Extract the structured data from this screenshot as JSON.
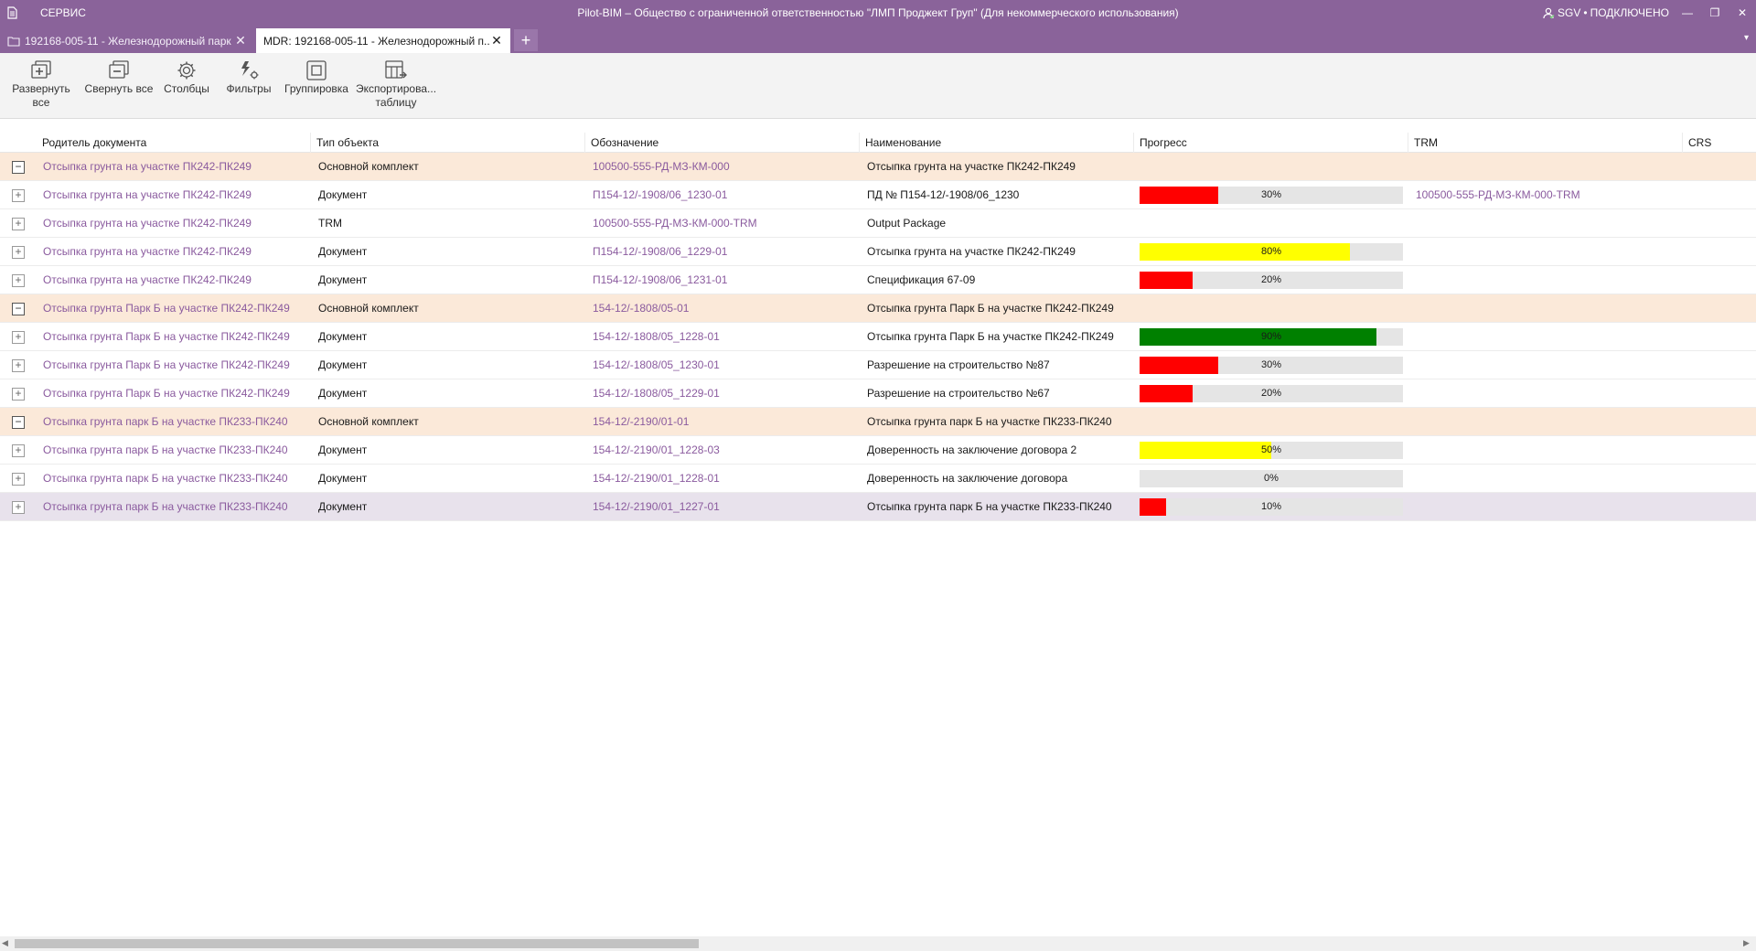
{
  "titlebar": {
    "menu": "СЕРВИС",
    "title": "Pilot-BIM – Общество с ограниченной ответственностью \"ЛМП Проджект Груп\" (Для некоммерческого использования)",
    "user": "SGV",
    "status": "ПОДКЛЮЧЕНО",
    "minimize": "—",
    "restore": "❐",
    "close": "✕"
  },
  "tabs": [
    {
      "label": "192168-005-11 - Железнодорожный парк",
      "close": "✕"
    },
    {
      "label": "MDR: 192168-005-11 - Железнодорожный п...",
      "close": "✕"
    }
  ],
  "tab_add": "+",
  "tab_menu": "▾",
  "toolbar": {
    "expand_all": "Развернуть все",
    "collapse_all": "Свернуть все",
    "columns": "Столбцы",
    "filters": "Фильтры",
    "grouping": "Группировка",
    "export_line1": "Экспортирова...",
    "export_line2": "таблицу"
  },
  "columns": {
    "parent": "Родитель документа",
    "type": "Тип объекта",
    "code": "Обозначение",
    "name": "Наименование",
    "progress": "Прогресс",
    "trm": "TRM",
    "crs": "CRS"
  },
  "rows": [
    {
      "group": true,
      "expander": "−",
      "parent": "Отсыпка грунта на участке ПК242-ПК249",
      "type": "Основной комплект",
      "code": "100500-555-РД-МЗ-КМ-000",
      "name": "Отсыпка грунта на участке ПК242-ПК249",
      "progress": null,
      "progress_label": "",
      "trm": ""
    },
    {
      "group": false,
      "expander": "+",
      "parent": "Отсыпка грунта на участке ПК242-ПК249",
      "type": "Документ",
      "code": "П154-12/-1908/06_1230-01",
      "name": "ПД № П154-12/-1908/06_1230",
      "progress": 0.3,
      "progress_label": "30%",
      "progress_color": "#ff0000",
      "trm": "100500-555-РД-МЗ-КМ-000-TRM"
    },
    {
      "group": false,
      "expander": "+",
      "parent": "Отсыпка грунта на участке ПК242-ПК249",
      "type": "TRM",
      "code": "100500-555-РД-МЗ-КМ-000-TRM",
      "name": "Output Package",
      "progress": null,
      "progress_label": "",
      "trm": ""
    },
    {
      "group": false,
      "expander": "+",
      "parent": "Отсыпка грунта на участке ПК242-ПК249",
      "type": "Документ",
      "code": "П154-12/-1908/06_1229-01",
      "name": "Отсыпка грунта на участке ПК242-ПК249",
      "progress": 0.8,
      "progress_label": "80%",
      "progress_color": "#ffff00",
      "trm": ""
    },
    {
      "group": false,
      "expander": "+",
      "parent": "Отсыпка грунта на участке ПК242-ПК249",
      "type": "Документ",
      "code": "П154-12/-1908/06_1231-01",
      "name": "Спецификация 67-09",
      "progress": 0.2,
      "progress_label": "20%",
      "progress_color": "#ff0000",
      "trm": ""
    },
    {
      "group": true,
      "expander": "−",
      "parent": "Отсыпка грунта Парк Б на участке ПК242-ПК249",
      "type": "Основной комплект",
      "code": "154-12/-1808/05-01",
      "name": "Отсыпка грунта Парк Б на участке ПК242-ПК249",
      "progress": null,
      "progress_label": "",
      "trm": ""
    },
    {
      "group": false,
      "expander": "+",
      "parent": "Отсыпка грунта Парк Б на участке ПК242-ПК249",
      "type": "Документ",
      "code": "154-12/-1808/05_1228-01",
      "name": "Отсыпка грунта Парк Б на участке ПК242-ПК249",
      "progress": 0.9,
      "progress_label": "90%",
      "progress_color": "#008000",
      "trm": ""
    },
    {
      "group": false,
      "expander": "+",
      "parent": "Отсыпка грунта Парк Б на участке ПК242-ПК249",
      "type": "Документ",
      "code": "154-12/-1808/05_1230-01",
      "name": "Разрешение на строительство №87",
      "progress": 0.3,
      "progress_label": "30%",
      "progress_color": "#ff0000",
      "trm": ""
    },
    {
      "group": false,
      "expander": "+",
      "parent": "Отсыпка грунта Парк Б на участке ПК242-ПК249",
      "type": "Документ",
      "code": "154-12/-1808/05_1229-01",
      "name": "Разрешение на строительство №67",
      "progress": 0.2,
      "progress_label": "20%",
      "progress_color": "#ff0000",
      "trm": ""
    },
    {
      "group": true,
      "expander": "−",
      "parent": "Отсыпка грунта парк Б на участке ПК233-ПК240",
      "type": "Основной комплект",
      "code": "154-12/-2190/01-01",
      "name": "Отсыпка грунта парк Б на участке ПК233-ПК240",
      "progress": null,
      "progress_label": "",
      "trm": ""
    },
    {
      "group": false,
      "expander": "+",
      "parent": "Отсыпка грунта парк Б на участке ПК233-ПК240",
      "type": "Документ",
      "code": "154-12/-2190/01_1228-03",
      "name": "Доверенность на заключение договора 2",
      "progress": 0.5,
      "progress_label": "50%",
      "progress_color": "#ffff00",
      "trm": ""
    },
    {
      "group": false,
      "expander": "+",
      "parent": "Отсыпка грунта парк Б на участке ПК233-ПК240",
      "type": "Документ",
      "code": "154-12/-2190/01_1228-01",
      "name": "Доверенность на заключение договора",
      "progress": 0.0,
      "progress_label": "0%",
      "progress_color": "#ff0000",
      "trm": ""
    },
    {
      "group": false,
      "selected": true,
      "expander": "+",
      "parent": "Отсыпка грунта парк Б на участке ПК233-ПК240",
      "type": "Документ",
      "code": "154-12/-2190/01_1227-01",
      "name": "Отсыпка грунта парк Б на участке ПК233-ПК240",
      "progress": 0.1,
      "progress_label": "10%",
      "progress_color": "#ff0000",
      "trm": ""
    }
  ],
  "scrollbar": {
    "left": "◀",
    "right": "▶"
  },
  "colors": {
    "accent": "#8a639a",
    "group_row": "#fbe9d9",
    "link": "#8a5a9e"
  }
}
